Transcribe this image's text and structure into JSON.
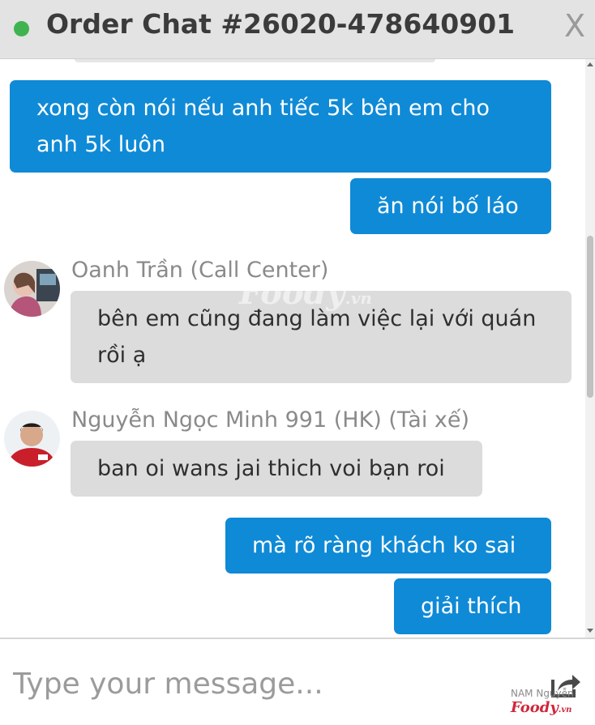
{
  "header": {
    "title": "Order Chat #26020-478640901",
    "close_label": "X",
    "status_color": "#3fb34f"
  },
  "messages": [
    {
      "from": "me",
      "text": "xong còn nói nếu anh tiếc 5k bên em cho anh 5k luôn"
    },
    {
      "from": "me",
      "text": "ăn nói bố láo"
    },
    {
      "from": "other",
      "sender": "Oanh Trần (Call Center)",
      "text": "bên em cũng đang làm việc lại với quán rồi ạ"
    },
    {
      "from": "other",
      "sender": "Nguyễn Ngọc Minh 991 (HK) (Tài xế)",
      "text": "ban oi wans jai thich voi bạn roi"
    },
    {
      "from": "me",
      "text": "mà rõ ràng khách ko sai"
    },
    {
      "from": "me",
      "text": "giải thích"
    }
  ],
  "watermark": {
    "text": "Foody",
    "suffix": ".vn"
  },
  "composer": {
    "placeholder": "Type your message...",
    "send_icon": "reply-arrow-icon"
  },
  "credit": {
    "author": "NAM Nguyễn",
    "logo": "Foody",
    "logo_suffix": ".vn"
  },
  "colors": {
    "my_bubble": "#0f8ad6",
    "their_bubble": "#dcdcdc",
    "header_bg": "#e3e3e3"
  }
}
